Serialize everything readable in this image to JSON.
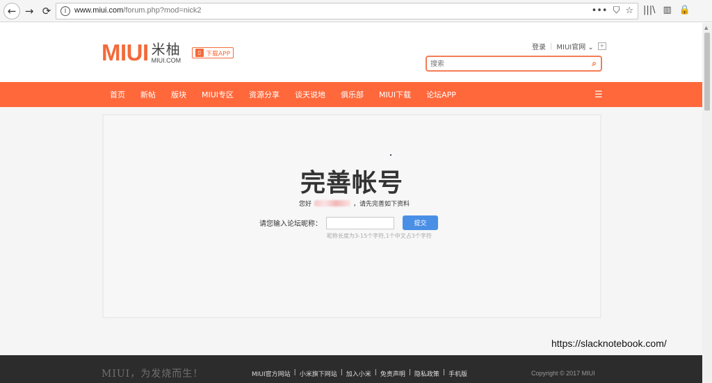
{
  "browser": {
    "url_host": "www.miui.com",
    "url_path": "/forum.php?mod=nick2",
    "back_icon": "←",
    "forward_icon": "→",
    "reload_icon": "⟳",
    "info_icon": "i",
    "more_icon": "•••",
    "pocket_icon": "⛉",
    "bookmark_icon": "☆",
    "library_icon": "|||\\",
    "sidebar_icon": "▥",
    "lock_icon": "🔒"
  },
  "header": {
    "logo_text": "MIUI",
    "logo_cn": "米柚",
    "logo_url": "MIUI.COM",
    "download_app": "下载APP",
    "download_icon": "▯",
    "login": "登录",
    "official_site": "MIUI官网",
    "official_caret": "⌄",
    "lang_switch": "+",
    "search_placeholder": "搜索",
    "search_icon": "⌕"
  },
  "nav": {
    "items": [
      "首页",
      "新帖",
      "版块",
      "MIUI专区",
      "资源分享",
      "谈天说地",
      "俱乐部",
      "MIUI下载",
      "论坛APP"
    ],
    "menu_icon": "☰"
  },
  "main": {
    "title": "完善帐号",
    "greeting_prefix": "您好",
    "greeting_suffix": "，请先完善如下资料",
    "nickname_label": "请您输入论坛昵称：",
    "nickname_value": "",
    "submit_label": "提交",
    "hint": "昵称长度为3-15个字符,1个中文占3个字符"
  },
  "watermark": "https://slacknotebook.com/",
  "footer": {
    "slogan": "MIUI，为发烧而生！",
    "links": [
      "MIUI官方网站",
      "小米旗下网站",
      "加入小米",
      "免责声明",
      "隐私政策",
      "手机版"
    ],
    "separator": "|",
    "copyright": "Copyright © 2017 MIUI"
  }
}
